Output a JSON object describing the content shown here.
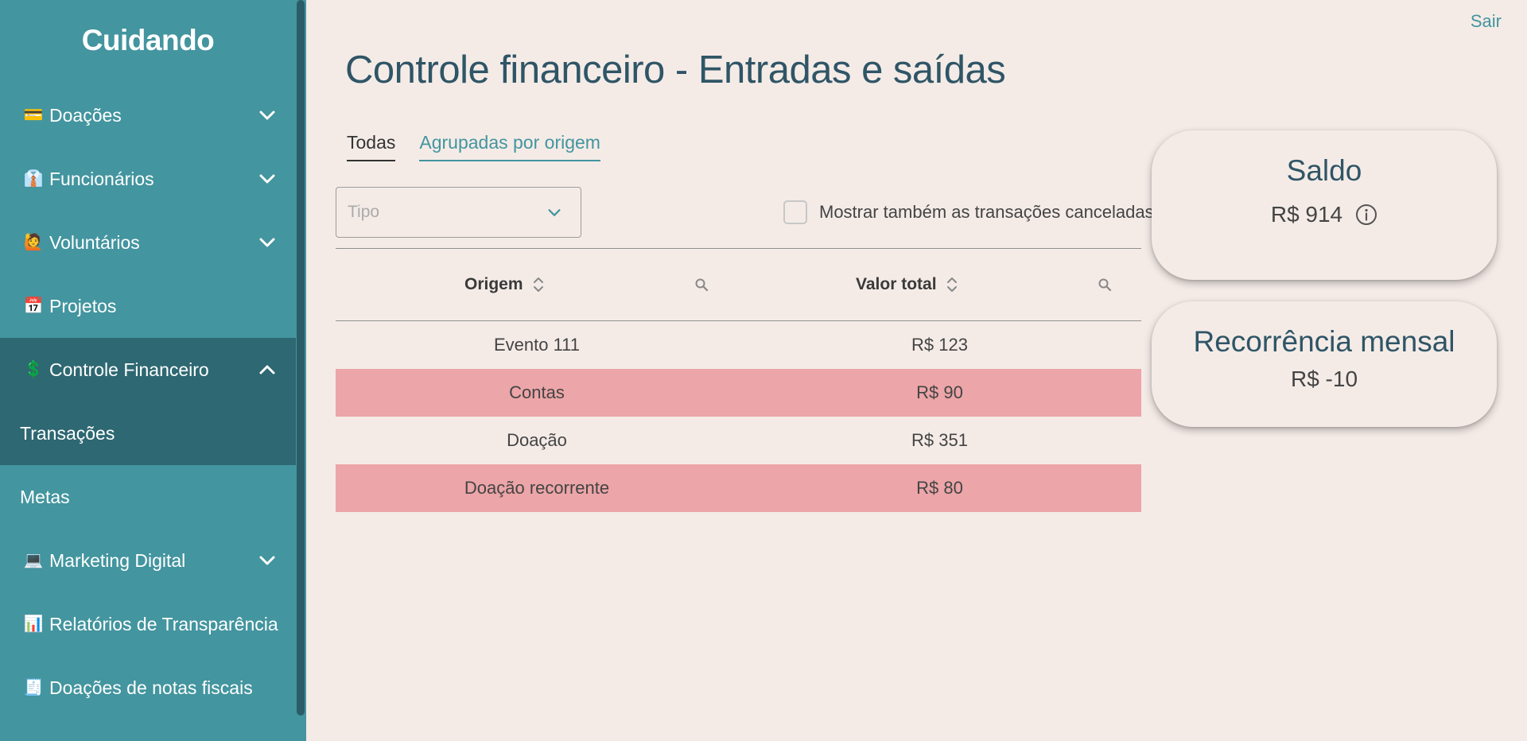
{
  "sidebar": {
    "brand": "Cuidando",
    "items": [
      {
        "label": "Doações",
        "icon": "credit-card-icon",
        "glyph": "💳"
      },
      {
        "label": "Funcionários",
        "icon": "necktie-icon",
        "glyph": "👔"
      },
      {
        "label": "Voluntários",
        "icon": "volunteer-icon",
        "glyph": "🙋"
      },
      {
        "label": "Projetos",
        "icon": "calendar-icon",
        "glyph": "📅"
      },
      {
        "label": "Controle Financeiro",
        "icon": "dollar-icon",
        "glyph": "💲"
      },
      {
        "label": "Transações"
      },
      {
        "label": "Metas"
      },
      {
        "label": "Marketing Digital",
        "icon": "laptop-icon",
        "glyph": "💻"
      },
      {
        "label": "Relatórios de Transparência",
        "icon": "bar-chart-icon",
        "glyph": "📊"
      },
      {
        "label": "Doações de notas fiscais",
        "icon": "receipt-icon",
        "glyph": "🧾"
      }
    ]
  },
  "header": {
    "logout": "Sair",
    "title": "Controle financeiro - Entradas e saídas"
  },
  "tabs": [
    {
      "label": "Todas"
    },
    {
      "label": "Agrupadas por origem"
    }
  ],
  "filters": {
    "type_placeholder": "Tipo",
    "show_cancelled_label": "Mostrar também as transações canceladas",
    "show_cancelled_checked": false
  },
  "table": {
    "columns": [
      "Origem",
      "Valor total"
    ],
    "rows": [
      {
        "origem": "Evento 111",
        "valor": "R$ 123",
        "negative": false
      },
      {
        "origem": "Contas",
        "valor": "R$ 90",
        "negative": true
      },
      {
        "origem": "Doação",
        "valor": "R$ 351",
        "negative": false
      },
      {
        "origem": "Doação recorrente",
        "valor": "R$ 80",
        "negative": true
      }
    ]
  },
  "cards": {
    "saldo": {
      "title": "Saldo",
      "value": "R$ 914"
    },
    "recorrencia": {
      "title": "Recorrência mensal",
      "value": "R$ -10"
    }
  },
  "colors": {
    "sidebar": "#43959f",
    "sidebar_active": "#2e6872",
    "background": "#f4ebe7",
    "negative_row": "#eca5a8",
    "accent": "#43959f",
    "title": "#2f5566"
  }
}
